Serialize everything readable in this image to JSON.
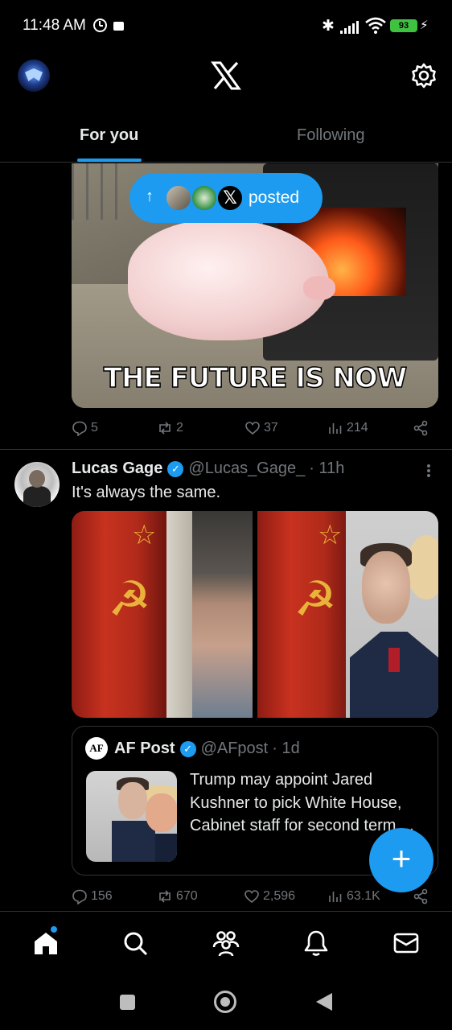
{
  "status_bar": {
    "time": "11:48 AM",
    "battery": "93"
  },
  "header": {
    "logo": "X"
  },
  "tabs": [
    {
      "label": "For you",
      "active": true
    },
    {
      "label": "Following",
      "active": false
    }
  ],
  "new_posts_pill": {
    "label": "posted"
  },
  "post1": {
    "image_caption": "THE FUTURE IS NOW",
    "replies": "5",
    "reposts": "2",
    "likes": "37",
    "views": "214"
  },
  "post2": {
    "author_name": "Lucas Gage",
    "author_handle": "@Lucas_Gage_",
    "time": "· 11h",
    "text": "It's always the same.",
    "quote": {
      "avatar_text": "AF",
      "author_name": "AF Post",
      "author_handle": "@AFpost",
      "time": "· 1d",
      "text": "Trump may appoint Jared Kushner to pick White House, Cabinet staff for second term...."
    },
    "replies": "156",
    "reposts": "670",
    "likes": "2,596",
    "views": "63.1K"
  },
  "fab": {
    "label": "+"
  },
  "colors": {
    "accent": "#1d9bf0",
    "background": "#000000",
    "text_primary": "#e7e9ea",
    "text_secondary": "#71767b",
    "divider": "#2f3336"
  },
  "icons": [
    "alarm-icon",
    "video-icon",
    "bluetooth-icon",
    "signal-icon",
    "wifi-icon",
    "battery-icon",
    "gear-icon",
    "reply-icon",
    "repost-icon",
    "like-icon",
    "views-icon",
    "share-icon",
    "home-icon",
    "search-icon",
    "communities-icon",
    "notifications-icon",
    "messages-icon"
  ]
}
